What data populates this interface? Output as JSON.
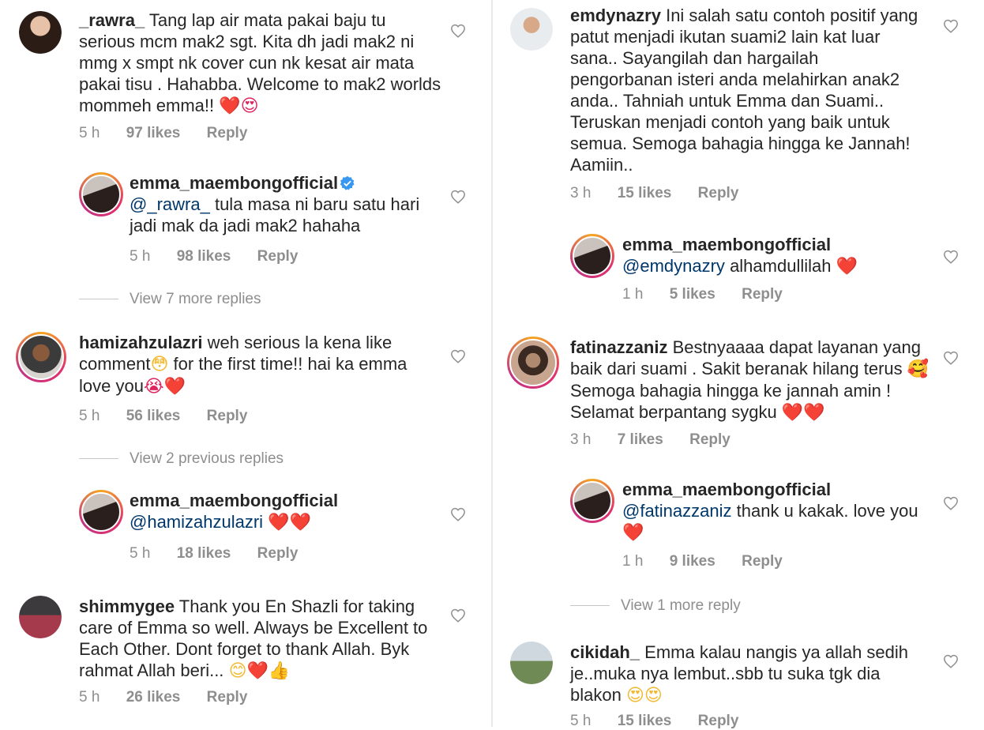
{
  "left": {
    "c1": {
      "username": "_rawra_",
      "text": "Tang lap air mata pakai baju tu serious mcm mak2 sgt. Kita dh jadi mak2 ni mmg x smpt nk cover cun nk kesat air mata pakai tisu . Hahabba. Welcome to mak2 worlds mommeh emma!!",
      "emoji": "❤️😍",
      "time": "5 h",
      "likes": "97 likes",
      "reply": "Reply"
    },
    "c2": {
      "username": "emma_maembongofficial",
      "mention": "@_rawra_",
      "text": "tula masa ni baru satu hari jadi mak da jadi mak2 hahaha",
      "time": "5 h",
      "likes": "98 likes",
      "reply": "Reply"
    },
    "view1": "View 7 more replies",
    "c3": {
      "username": "hamizahzulazri",
      "text_a": "weh serious la kena like comment",
      "text_b": "for the first time!! hai ka emma love you",
      "emoji_a": "😳",
      "emoji_b": "😭❤️",
      "time": "5 h",
      "likes": "56 likes",
      "reply": "Reply"
    },
    "view2": "View 2 previous replies",
    "c4": {
      "username": "emma_maembongofficial",
      "mention": "@hamizahzulazri",
      "emoji": "❤️❤️",
      "time": "5 h",
      "likes": "18 likes",
      "reply": "Reply"
    },
    "c5": {
      "username": "shimmygee",
      "text": "Thank you En Shazli for taking care of Emma so well. Always be Excellent to Each Other. Dont forget to thank Allah. Byk rahmat Allah beri...",
      "emoji": "😊❤️👍",
      "time": "5 h",
      "likes": "26 likes",
      "reply": "Reply"
    }
  },
  "right": {
    "c1": {
      "username": "emdynazry",
      "text": "Ini salah satu contoh positif yang patut menjadi ikutan suami2 lain kat luar sana.. Sayangilah dan hargailah pengorbanan isteri anda melahirkan anak2 anda.. Tahniah untuk Emma dan Suami.. Teruskan menjadi contoh yang baik untuk semua. Semoga bahagia hingga ke Jannah! Aamiin..",
      "time": "3 h",
      "likes": "15 likes",
      "reply": "Reply"
    },
    "c2": {
      "username": "emma_maembongofficial",
      "mention": "@emdynazry",
      "text": "alhamdullilah",
      "emoji": "❤️",
      "time": "1 h",
      "likes": "5 likes",
      "reply": "Reply"
    },
    "c3": {
      "username": "fatinazzaniz",
      "text_a": "Bestnyaaaa dapat layanan yang baik dari suami . Sakit beranak hilang terus",
      "emoji_a": "🥰",
      "text_b": "Semoga bahagia hingga ke jannah amin ! Selamat berpantang sygku",
      "emoji_b": "❤️❤️",
      "time": "3 h",
      "likes": "7 likes",
      "reply": "Reply"
    },
    "c4": {
      "username": "emma_maembongofficial",
      "mention": "@fatinazzaniz",
      "text": "thank u kakak. love you",
      "emoji": "❤️",
      "time": "1 h",
      "likes": "9 likes",
      "reply": "Reply"
    },
    "view1": "View 1 more reply",
    "c5": {
      "username": "cikidah_",
      "text": "Emma kalau nangis ya allah sedih je..muka nya lembut..sbb tu suka tgk dia blakon",
      "emoji": "😍😍",
      "time": "5 h",
      "likes": "15 likes",
      "reply": "Reply"
    }
  }
}
